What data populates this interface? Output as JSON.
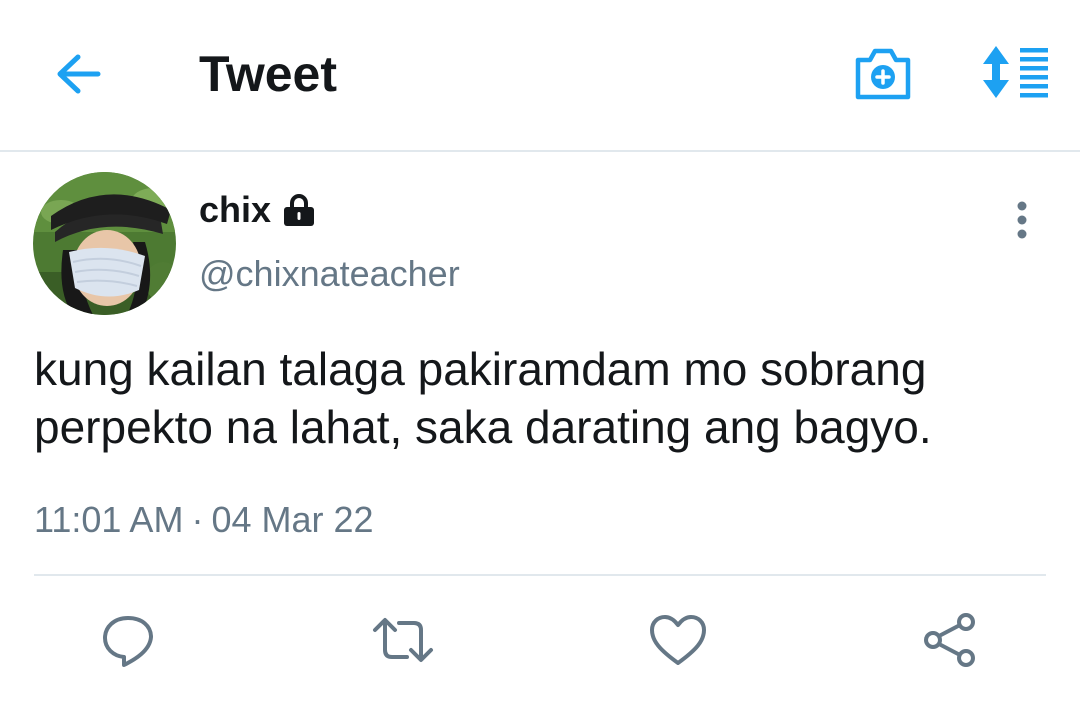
{
  "header": {
    "title": "Tweet",
    "back_icon": "arrow-left-icon",
    "camera_icon": "camera-add-icon",
    "sort_icon": "sort-lines-icon",
    "accent_color": "#1da1f2"
  },
  "tweet": {
    "display_name": "chix",
    "protected_icon": "lock-icon",
    "handle": "@chixnateacher",
    "text": "kung kailan talaga pakiramdam mo sobrang perpekto na lahat, saka darating ang bagyo.",
    "time": "11:01 AM",
    "separator": "·",
    "date": "04 Mar 22"
  },
  "actions": [
    {
      "icon": "reply-icon"
    },
    {
      "icon": "retweet-icon"
    },
    {
      "icon": "like-icon"
    },
    {
      "icon": "share-icon"
    }
  ],
  "colors": {
    "text_primary": "#14171a",
    "text_secondary": "#657786",
    "divider": "#e1e8ed",
    "action_icon": "#657786"
  }
}
